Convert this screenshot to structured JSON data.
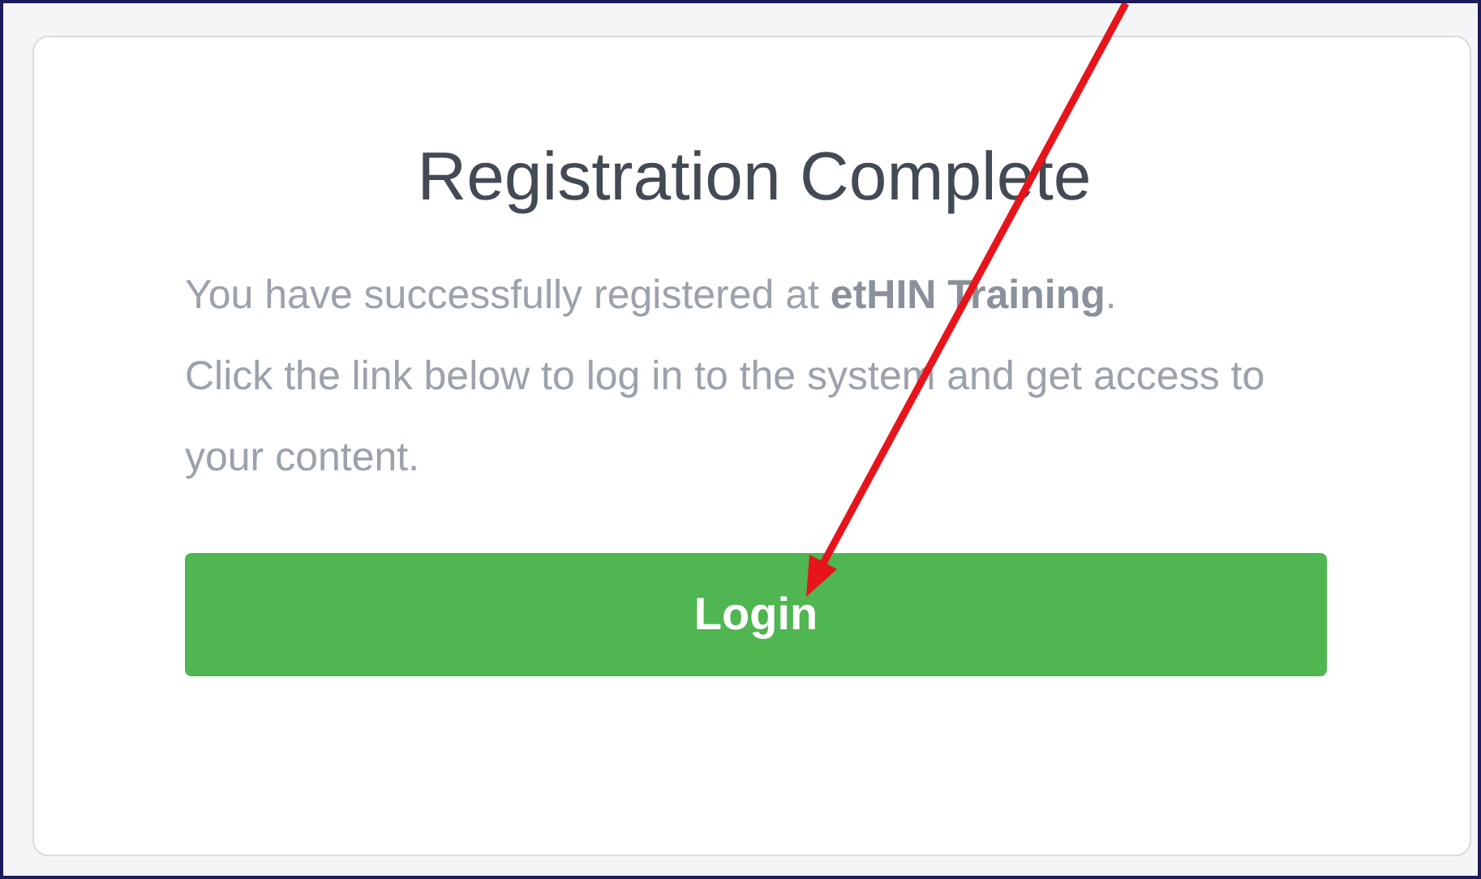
{
  "card": {
    "title": "Registration Complete",
    "message": "You have successfully registered at **etHIN Training**.\nClick the link below to log in to the system and get access to your content.",
    "button": "Login"
  }
}
